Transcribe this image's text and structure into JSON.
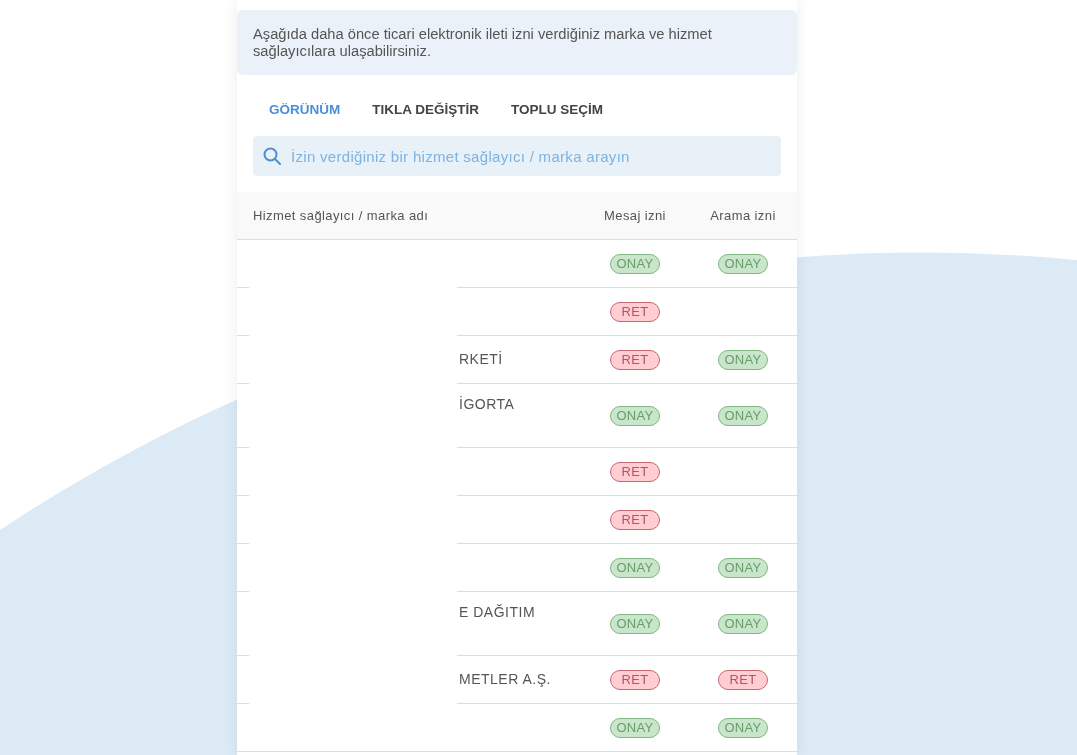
{
  "notice": "Aşağıda daha önce ticari elektronik ileti izni verdiğiniz marka ve hizmet sağlayıcılara ulaşabilirsiniz.",
  "tabs": [
    {
      "label": "GÖRÜNÜM",
      "selected": true
    },
    {
      "label": "TIKLA DEĞİŞTİR",
      "selected": false
    },
    {
      "label": "TOPLU SEÇİM",
      "selected": false
    }
  ],
  "search": {
    "placeholder": "İzin verdiğiniz bir hizmet sağlayıcı / marka arayın"
  },
  "table": {
    "columns": [
      "Hizmet sağlayıcı / marka adı",
      "Mesaj izni",
      "Arama izni"
    ],
    "rows": [
      {
        "kind": "single",
        "message": {
          "label": "ONAY",
          "kind": "approved"
        },
        "call": {
          "label": "ONAY",
          "kind": "approved"
        }
      },
      {
        "kind": "single",
        "message": {
          "label": "RET",
          "kind": "rejected"
        }
      },
      {
        "kind": "single",
        "name": "RKETİ",
        "message": {
          "label": "RET",
          "kind": "rejected"
        },
        "call": {
          "label": "ONAY",
          "kind": "approved"
        }
      },
      {
        "kind": "double",
        "name": "İGORTA",
        "message": {
          "label": "ONAY",
          "kind": "approved"
        },
        "call": {
          "label": "ONAY",
          "kind": "approved"
        }
      },
      {
        "kind": "single",
        "message": {
          "label": "RET",
          "kind": "rejected"
        }
      },
      {
        "kind": "single",
        "message": {
          "label": "RET",
          "kind": "rejected"
        }
      },
      {
        "kind": "single",
        "message": {
          "label": "ONAY",
          "kind": "approved"
        },
        "call": {
          "label": "ONAY",
          "kind": "approved"
        }
      },
      {
        "kind": "double",
        "name": "E DAĞITIM",
        "message": {
          "label": "ONAY",
          "kind": "approved"
        },
        "call": {
          "label": "ONAY",
          "kind": "approved"
        }
      },
      {
        "kind": "single",
        "name": "METLER A.Ş.",
        "message": {
          "label": "RET",
          "kind": "rejected"
        },
        "call": {
          "label": "RET",
          "kind": "rejected"
        }
      },
      {
        "kind": "single",
        "message": {
          "label": "ONAY",
          "kind": "approved"
        },
        "call": {
          "label": "ONAY",
          "kind": "approved"
        }
      }
    ]
  }
}
